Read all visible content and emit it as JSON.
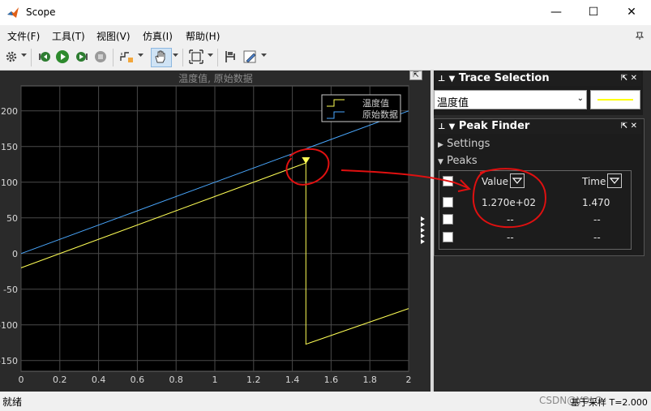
{
  "window": {
    "title": "Scope",
    "minimize_glyph": "—",
    "maximize_glyph": "☐",
    "close_glyph": "✕"
  },
  "menu": {
    "items": [
      "文件(F)",
      "工具(T)",
      "视图(V)",
      "仿真(I)",
      "帮助(H)"
    ]
  },
  "toolbar": {
    "icons": [
      "gear-icon",
      "step-back-icon",
      "run-icon",
      "step-forward-icon",
      "stop-icon",
      "trigger-icon",
      "pan-icon",
      "zoom-fit-icon",
      "cursor-measure-icon",
      "style-icon"
    ]
  },
  "plot": {
    "expand_glyph": "⇱"
  },
  "chart_data": {
    "type": "line",
    "title": "温度值, 原始数据",
    "xlim": [
      0,
      2
    ],
    "ylim": [
      -165,
      235
    ],
    "x_ticks": [
      "0",
      "0.2",
      "0.4",
      "0.6",
      "0.8",
      "1",
      "1.2",
      "1.4",
      "1.6",
      "1.8",
      "2"
    ],
    "y_ticks": [
      "-150",
      "-100",
      "-50",
      "0",
      "50",
      "100",
      "150",
      "200"
    ],
    "grid": true,
    "legend_position": "top-right",
    "series": [
      {
        "name": "温度值",
        "color": "#ffff55",
        "points": [
          [
            0,
            -20
          ],
          [
            1.47,
            127
          ],
          [
            1.47,
            -127
          ],
          [
            2,
            -77
          ]
        ]
      },
      {
        "name": "原始数据",
        "color": "#4aa8ff",
        "points": [
          [
            0,
            0
          ],
          [
            2,
            200
          ]
        ]
      }
    ],
    "peak_marker": {
      "x": 1.47,
      "y": 127
    },
    "annotation_color": "#e01010"
  },
  "trace_selection": {
    "title": "Trace Selection",
    "selected": "温度值",
    "swatch_color": "#ffff00"
  },
  "peak_finder": {
    "title": "Peak Finder",
    "settings_label": "Settings",
    "peaks_label": "Peaks",
    "columns": [
      "Value",
      "Time"
    ],
    "rows": [
      {
        "value": "1.270e+02",
        "time": "1.470"
      },
      {
        "value": "--",
        "time": "--"
      },
      {
        "value": "--",
        "time": "--"
      }
    ]
  },
  "status": {
    "left": "就绪",
    "right": "基于采样 T=2.000",
    "watermark": "CSDN@YOLO"
  }
}
